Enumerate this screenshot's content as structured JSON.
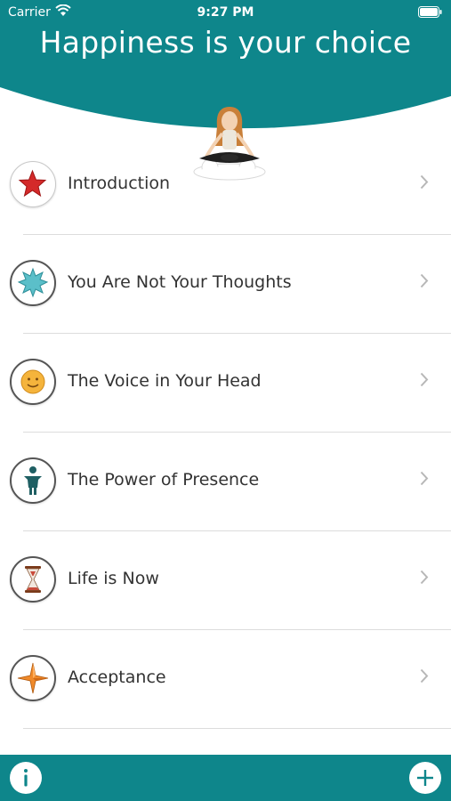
{
  "status_bar": {
    "carrier": "Carrier",
    "time": "9:27 PM"
  },
  "header": {
    "title": "Happiness is your choice",
    "background_color": "#0e868b"
  },
  "chapters": [
    {
      "label": "Introduction",
      "icon": "red-star-icon"
    },
    {
      "label": "You Are Not Your Thoughts",
      "icon": "teal-burst-icon"
    },
    {
      "label": "The Voice in Your Head",
      "icon": "smiley-face-icon"
    },
    {
      "label": "The Power of Presence",
      "icon": "meditating-figure-icon"
    },
    {
      "label": "Life is Now",
      "icon": "hourglass-icon"
    },
    {
      "label": "Acceptance",
      "icon": "compass-star-icon"
    }
  ],
  "bottom_bar": {
    "info_icon": "info-icon",
    "add_icon": "plus-icon"
  }
}
